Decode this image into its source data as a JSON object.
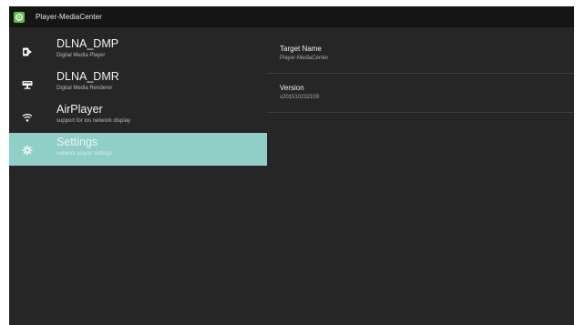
{
  "app": {
    "title": "Player-MediaCenter",
    "icon": "gear-leaf-icon"
  },
  "sidebar": {
    "items": [
      {
        "label": "DLNA_DMP",
        "subtitle": "Digital Media Player",
        "icon": "media-player-icon",
        "selected": false
      },
      {
        "label": "DLNA_DMR",
        "subtitle": "Digital Media Renderer",
        "icon": "renderer-icon",
        "selected": false
      },
      {
        "label": "AirPlayer",
        "subtitle": "support for ios network display",
        "icon": "wifi-icon",
        "selected": false
      },
      {
        "label": "Settings",
        "subtitle": "network player settings",
        "icon": "gear-icon",
        "selected": true
      }
    ]
  },
  "details": [
    {
      "label": "Target Name",
      "value": "Player-MediaCenter"
    },
    {
      "label": "Version",
      "value": "v201510232109"
    }
  ],
  "colors": {
    "background": "#262626",
    "titlebar": "#151515",
    "selected": "#8fcfc7",
    "accent": "#5fbf4a"
  }
}
